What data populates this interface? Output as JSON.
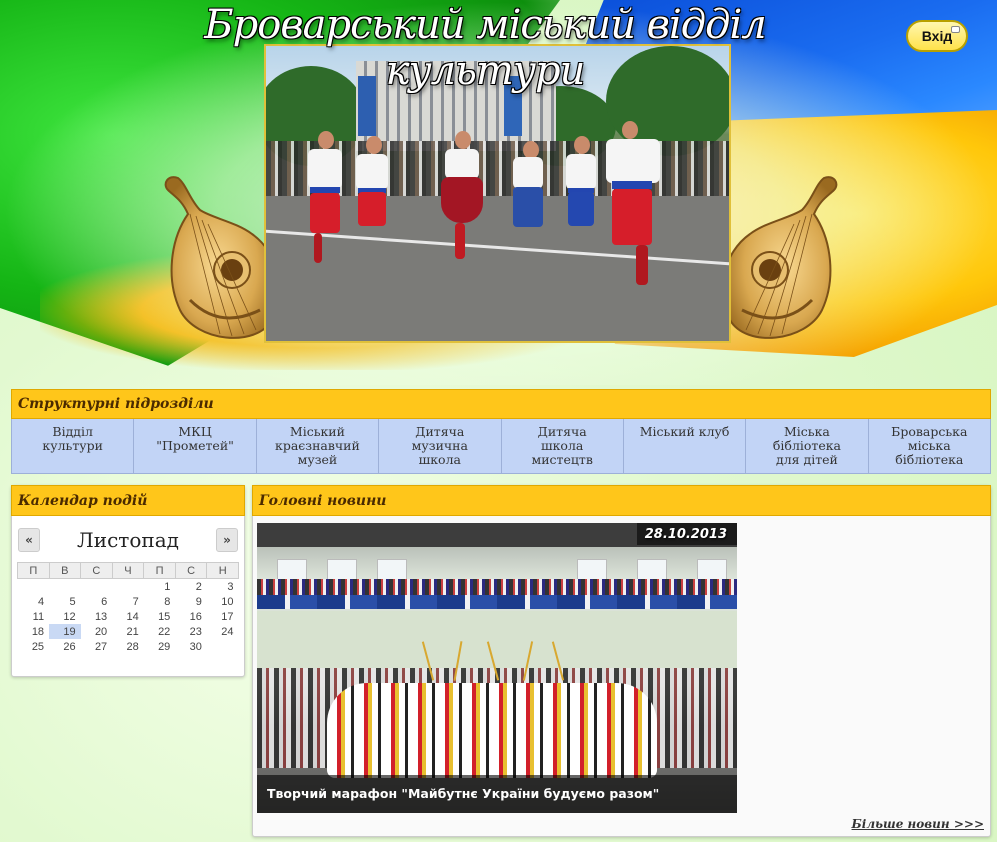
{
  "header": {
    "site_title": "Броварський міський відділ культури",
    "login_label": "Вхід"
  },
  "structural_units": {
    "title": "Структурні підрозділи",
    "items": [
      {
        "label": "Відділ\nкультури"
      },
      {
        "label": "МКЦ\n\"Прометей\""
      },
      {
        "label": "Міський\nкраєзнавчий\nмузей"
      },
      {
        "label": "Дитяча\nмузична\nшкола"
      },
      {
        "label": "Дитяча\nшкола\nмистецтв"
      },
      {
        "label": "Міський клуб"
      },
      {
        "label": "Міська\nбібліотека\nдля дітей"
      },
      {
        "label": "Броварська\nміська\nбібліотека"
      }
    ]
  },
  "calendar": {
    "title": "Календар подій",
    "prev_label": "«",
    "next_label": "»",
    "month": "Листопад",
    "weekdays": [
      "П",
      "В",
      "С",
      "Ч",
      "П",
      "С",
      "Н"
    ],
    "weeks": [
      [
        "",
        "",
        "",
        "",
        "1",
        "2",
        "3"
      ],
      [
        "4",
        "5",
        "6",
        "7",
        "8",
        "9",
        "10"
      ],
      [
        "11",
        "12",
        "13",
        "14",
        "15",
        "16",
        "17"
      ],
      [
        "18",
        "19",
        "20",
        "21",
        "22",
        "23",
        "24"
      ],
      [
        "25",
        "26",
        "27",
        "28",
        "29",
        "30",
        ""
      ]
    ],
    "today": "19"
  },
  "news": {
    "title": "Головні новини",
    "date": "28.10.2013",
    "caption": "Творчий марафон \"Майбутнє України будуємо разом\"",
    "more_label": "Більше новин >>>"
  },
  "colors": {
    "accent_bar": "#ffc61a",
    "struct_item_bg": "#c2d4f6",
    "calendar_today": "#c9d9f4"
  }
}
